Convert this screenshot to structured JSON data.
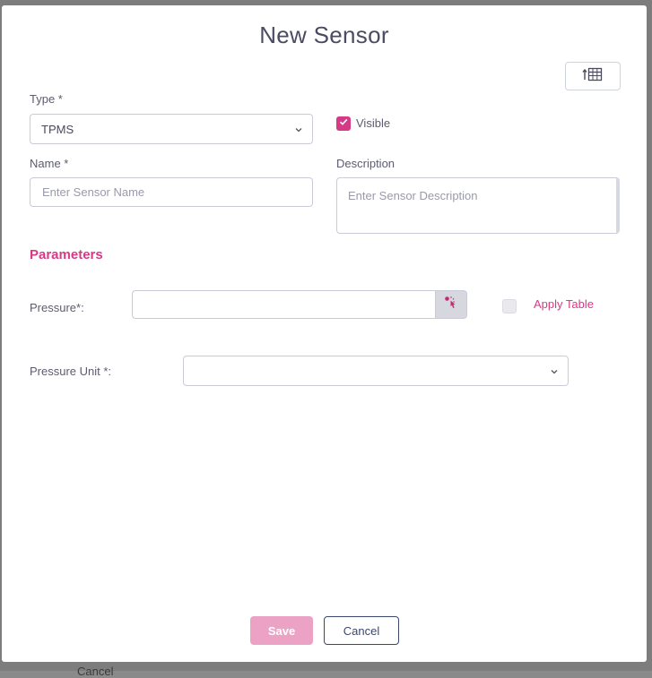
{
  "dialog": {
    "title": "New Sensor",
    "table_button_icon": "table-arrow-up-icon"
  },
  "form": {
    "type": {
      "label": "Type *",
      "value": "TPMS"
    },
    "visible": {
      "label": "Visible",
      "checked": true
    },
    "name": {
      "label": "Name *",
      "placeholder": "Enter Sensor Name",
      "value": ""
    },
    "description": {
      "label": "Description",
      "placeholder": "Enter Sensor Description",
      "value": ""
    }
  },
  "parameters": {
    "title": "Parameters",
    "pressure": {
      "label": "Pressure*:",
      "value": "",
      "picker_icon": "pointer-click-icon"
    },
    "apply_table": {
      "label": "Apply Table",
      "checked": false
    },
    "pressure_unit": {
      "label": "Pressure Unit *:",
      "value": ""
    }
  },
  "actions": {
    "save_label": "Save",
    "cancel_label": "Cancel"
  },
  "background": {
    "partial_text": "Cancel"
  },
  "colors": {
    "accent": "#d63a86",
    "save_disabled": "#eba2c4",
    "cancel_border": "#3b4770",
    "title": "#4b4b63"
  }
}
